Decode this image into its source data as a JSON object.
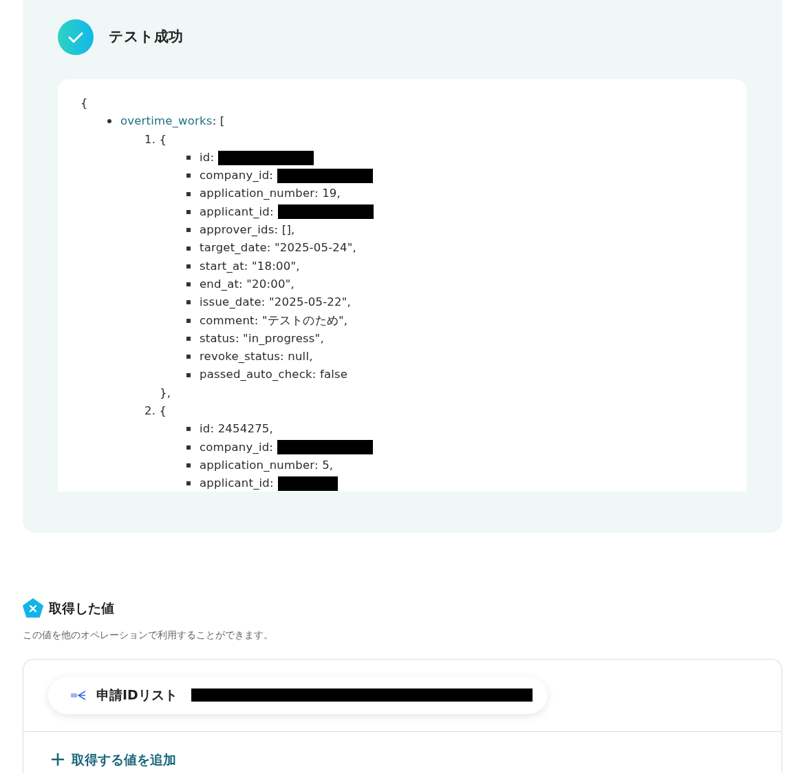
{
  "result": {
    "title": "テスト成功",
    "json_view": {
      "open": "{",
      "key": "overtime_works",
      "after_key": ": [",
      "items": [
        {
          "label": "1. {",
          "fields": [
            {
              "text": "id:",
              "redacted": true
            },
            {
              "text": "company_id:",
              "redacted": true
            },
            {
              "text": "application_number: 19,",
              "redacted": false
            },
            {
              "text": "applicant_id:",
              "redacted": true
            },
            {
              "text": "approver_ids: [],",
              "redacted": false
            },
            {
              "text": "target_date: \"2025-05-24\",",
              "redacted": false
            },
            {
              "text": "start_at: \"18:00\",",
              "redacted": false
            },
            {
              "text": "end_at: \"20:00\",",
              "redacted": false
            },
            {
              "text": "issue_date: \"2025-05-22\",",
              "redacted": false
            },
            {
              "text": "comment: \"テストのため\",",
              "redacted": false
            },
            {
              "text": "status: \"in_progress\",",
              "redacted": false
            },
            {
              "text": "revoke_status: null,",
              "redacted": false
            },
            {
              "text": "passed_auto_check: false",
              "redacted": false
            }
          ],
          "close": "},"
        },
        {
          "label": "2. {",
          "fields": [
            {
              "text": "id: 2454275,",
              "redacted": false
            },
            {
              "text": "company_id:",
              "redacted": true
            },
            {
              "text": "application_number: 5,",
              "redacted": false
            },
            {
              "text": "applicant_id:",
              "redacted": true
            }
          ]
        }
      ]
    }
  },
  "acquired": {
    "title": "取得した値",
    "description": "この値を他のオペレーションで利用することができます。",
    "values": [
      {
        "label": "申請IDリスト",
        "redacted": true
      }
    ],
    "add_button": "取得する値を追加"
  }
}
